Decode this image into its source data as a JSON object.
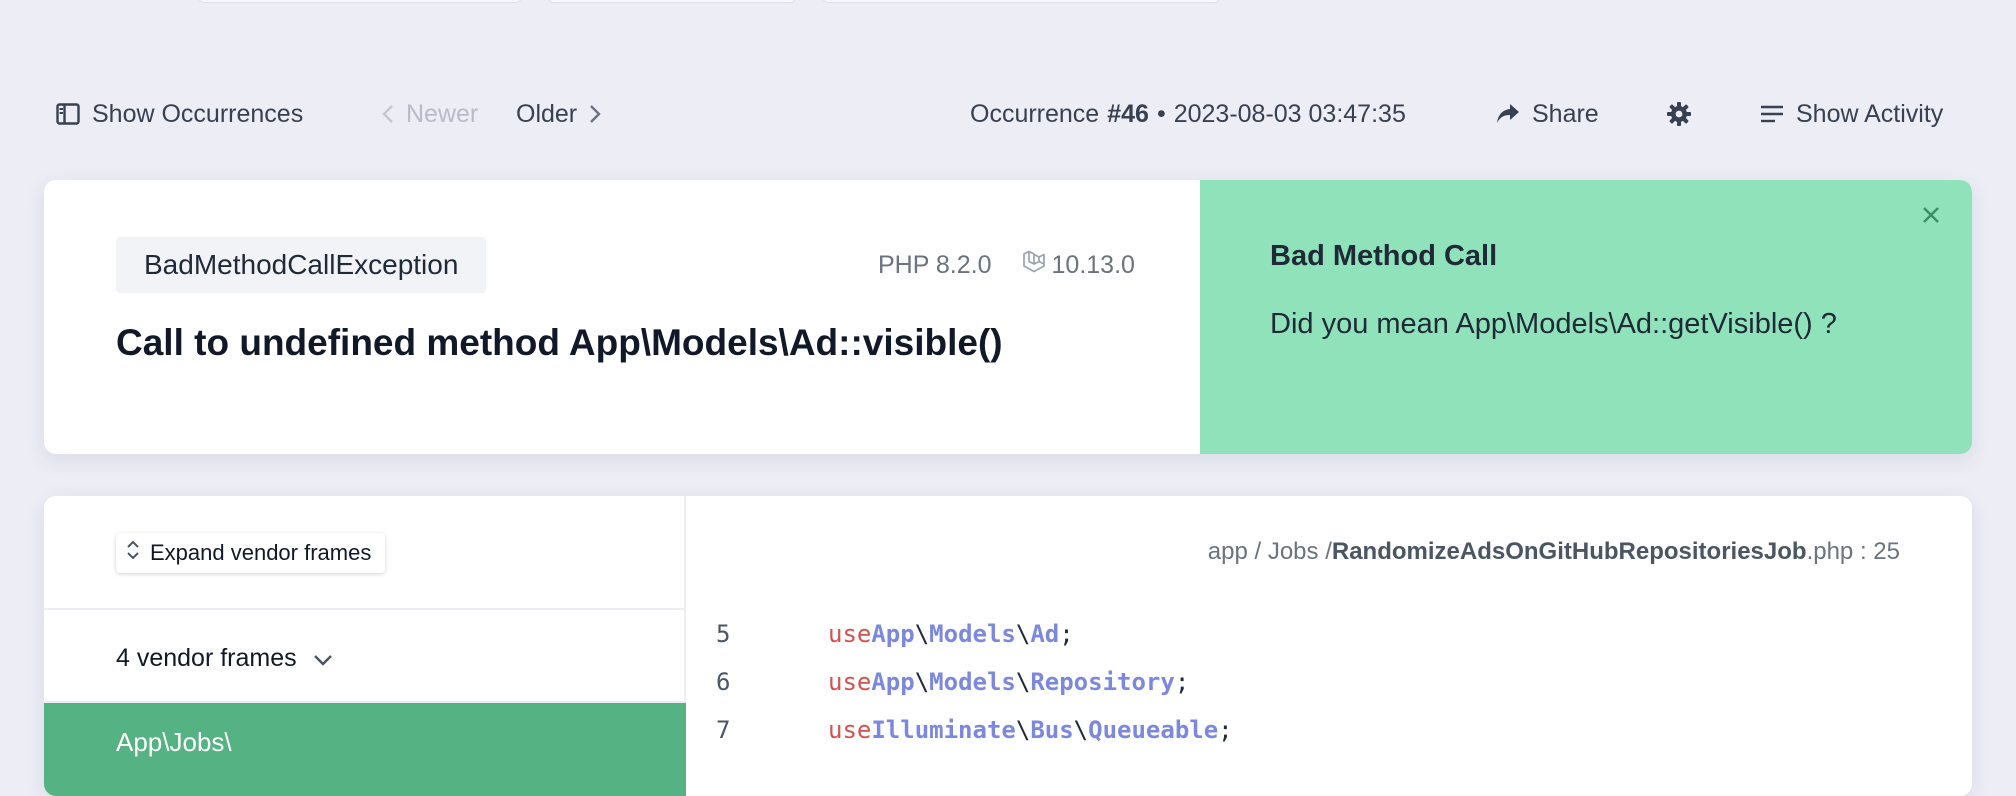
{
  "toolbar": {
    "show_occurrences": "Show Occurrences",
    "newer": "Newer",
    "older": "Older",
    "occurrence_prefix": "Occurrence",
    "occurrence_number": "#46",
    "occurrence_sep": "•",
    "occurrence_time": "2023-08-03 03:47:35",
    "share": "Share",
    "show_activity": "Show Activity"
  },
  "error": {
    "exception_class": "BadMethodCallException",
    "php_version": "PHP 8.2.0",
    "laravel_version": "10.13.0",
    "message": "Call to undefined method App\\Models\\Ad::visible()"
  },
  "solution": {
    "title": "Bad Method Call",
    "text": "Did you mean App\\Models\\Ad::getVisible() ?"
  },
  "frames": {
    "expand_label": "Expand vendor frames",
    "vendor_frames_label": "4 vendor frames",
    "active_frame_label": "App\\Jobs\\"
  },
  "code": {
    "path_dir1": "app",
    "path_sep": "/",
    "path_dir2": "Jobs",
    "file_name": "RandomizeAdsOnGitHubRepositoriesJob",
    "file_ext": ".php",
    "line_sep": ":",
    "line": "25",
    "lines": [
      {
        "number": "5",
        "keyword": "use",
        "parts": [
          "App",
          "Models",
          "Ad"
        ]
      },
      {
        "number": "6",
        "keyword": "use",
        "parts": [
          "App",
          "Models",
          "Repository"
        ]
      },
      {
        "number": "7",
        "keyword": "use",
        "parts": [
          "Illuminate",
          "Bus",
          "Queueable"
        ]
      }
    ],
    "ns_sep": "\\",
    "terminator": ";"
  },
  "colors": {
    "solution_bg": "#8fe2b9",
    "active_frame_bg": "#55b283",
    "keyword": "#d65050",
    "namespace": "#7c87e0"
  }
}
